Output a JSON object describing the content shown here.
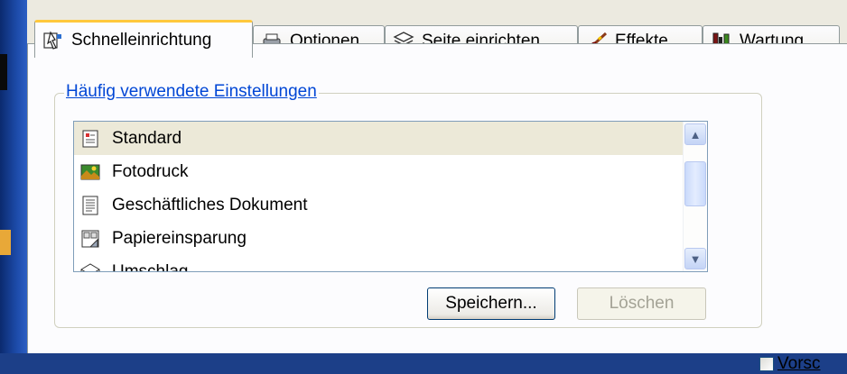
{
  "tabs": [
    {
      "label": "Schnelleinrichtung",
      "icon": "quick-setup-icon",
      "active": true
    },
    {
      "label": "Optionen",
      "icon": "printer-icon",
      "active": false
    },
    {
      "label": "Seite einrichten",
      "icon": "page-stack-icon",
      "active": false
    },
    {
      "label": "Effekte",
      "icon": "brush-icon",
      "active": false
    },
    {
      "label": "Wartung",
      "icon": "tools-icon",
      "active": false
    }
  ],
  "group": {
    "title": "Häufig verwendete Einstellungen",
    "items": [
      {
        "label": "Standard",
        "icon": "standard-doc-icon",
        "selected": true
      },
      {
        "label": "Fotodruck",
        "icon": "photo-icon",
        "selected": false
      },
      {
        "label": "Geschäftliches Dokument",
        "icon": "document-icon",
        "selected": false
      },
      {
        "label": "Papiereinsparung",
        "icon": "paper-saving-icon",
        "selected": false
      },
      {
        "label": "Umschlag",
        "icon": "envelope-icon",
        "selected": false
      }
    ]
  },
  "buttons": {
    "save": "Speichern...",
    "delete": "Löschen"
  },
  "preview_checkbox": {
    "label": "Vorsc",
    "checked": false
  },
  "colors": {
    "accent": "#ffc83c",
    "group_title": "#0046d5"
  }
}
